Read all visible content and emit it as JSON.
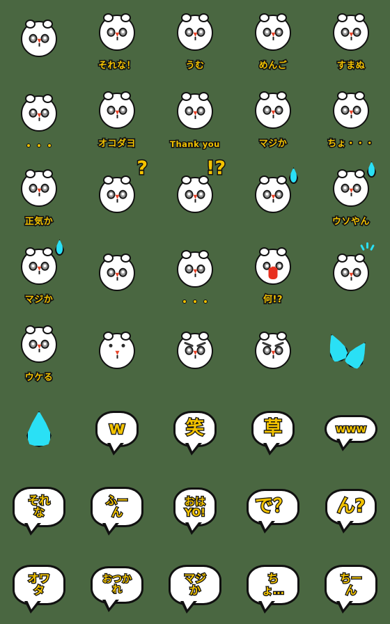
{
  "sheet": {
    "background_color": "#4a6741",
    "columns": 5,
    "rows": 8,
    "accent_color": "#f2c200",
    "outline_color": "#111111",
    "drop_color": "#2ae0f5",
    "mouth_color": "#e8301f"
  },
  "stickers": [
    {
      "id": "s01",
      "kind": "face",
      "label": "",
      "decor": "none"
    },
    {
      "id": "s02",
      "kind": "face",
      "label": "それな！",
      "decor": "none"
    },
    {
      "id": "s03",
      "kind": "face",
      "label": "うむ",
      "decor": "none"
    },
    {
      "id": "s04",
      "kind": "face",
      "label": "めんご",
      "decor": "none"
    },
    {
      "id": "s05",
      "kind": "face",
      "label": "すまぬ",
      "decor": "none"
    },
    {
      "id": "s06",
      "kind": "face",
      "label": "",
      "decor": "dots"
    },
    {
      "id": "s07",
      "kind": "face",
      "label": "オコダヨ",
      "decor": "none"
    },
    {
      "id": "s08",
      "kind": "face",
      "label": "Thank you",
      "decor": "none"
    },
    {
      "id": "s09",
      "kind": "face",
      "label": "マジか",
      "decor": "none"
    },
    {
      "id": "s10",
      "kind": "face",
      "label": "ちょ・・・",
      "decor": "none"
    },
    {
      "id": "s11",
      "kind": "face",
      "label": "正気か",
      "decor": "none"
    },
    {
      "id": "s12",
      "kind": "face",
      "label": "",
      "decor": "question",
      "mark": "?"
    },
    {
      "id": "s13",
      "kind": "face",
      "label": "",
      "decor": "question",
      "mark": "!?"
    },
    {
      "id": "s14",
      "kind": "face",
      "label": "",
      "decor": "sweat"
    },
    {
      "id": "s15",
      "kind": "face",
      "label": "ウソやん",
      "decor": "sweat"
    },
    {
      "id": "s16",
      "kind": "face",
      "label": "マジか",
      "decor": "sweat"
    },
    {
      "id": "s17",
      "kind": "face",
      "label": "",
      "decor": "none"
    },
    {
      "id": "s18",
      "kind": "face",
      "label": "",
      "decor": "dots"
    },
    {
      "id": "s19",
      "kind": "face",
      "label": "何!?",
      "decor": "shout"
    },
    {
      "id": "s20",
      "kind": "face",
      "label": "",
      "decor": "sparks"
    },
    {
      "id": "s21",
      "kind": "face",
      "label": "ウケる",
      "decor": "none"
    },
    {
      "id": "s22",
      "kind": "face",
      "label": "",
      "decor": "doteyes"
    },
    {
      "id": "s23",
      "kind": "face",
      "label": "",
      "decor": "angry"
    },
    {
      "id": "s24",
      "kind": "face",
      "label": "",
      "decor": "angry"
    },
    {
      "id": "s25",
      "kind": "twodrops",
      "label": "",
      "decor": "none"
    },
    {
      "id": "s26",
      "kind": "bigdrop",
      "label": "",
      "decor": "none"
    },
    {
      "id": "s27",
      "kind": "bubble",
      "label": "w",
      "size": "lg"
    },
    {
      "id": "s28",
      "kind": "bubble",
      "label": "笑",
      "size": "lg"
    },
    {
      "id": "s29",
      "kind": "bubble",
      "label": "草",
      "size": "lg"
    },
    {
      "id": "s30",
      "kind": "bubble",
      "label": "www",
      "size": "sm"
    },
    {
      "id": "s31",
      "kind": "bubble",
      "label": "それな",
      "size": "sm"
    },
    {
      "id": "s32",
      "kind": "bubble",
      "label": "ふーん",
      "size": "sm"
    },
    {
      "id": "s33",
      "kind": "bubble",
      "label": "おは\nYO!",
      "size": "two"
    },
    {
      "id": "s34",
      "kind": "bubble",
      "label": "で？",
      "size": "lg"
    },
    {
      "id": "s35",
      "kind": "bubble",
      "label": "ん?",
      "size": "lg"
    },
    {
      "id": "s36",
      "kind": "bubble",
      "label": "オワタ",
      "size": "sm"
    },
    {
      "id": "s37",
      "kind": "bubble",
      "label": "おつかれ",
      "size": "xs"
    },
    {
      "id": "s38",
      "kind": "bubble",
      "label": "マジか",
      "size": "sm"
    },
    {
      "id": "s39",
      "kind": "bubble",
      "label": "ちょ…",
      "size": "sm"
    },
    {
      "id": "s40",
      "kind": "bubble",
      "label": "ちーん",
      "size": "sm"
    }
  ]
}
